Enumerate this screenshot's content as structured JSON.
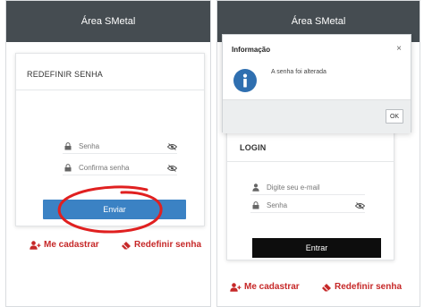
{
  "left": {
    "header_title": "Área SMetal",
    "card_title": "REDEFINIR SENHA",
    "password_placeholder": "Senha",
    "confirm_placeholder": "Confirma senha",
    "submit_label": "Enviar",
    "register_link": "Me cadastrar",
    "reset_link": "Redefinir senha"
  },
  "right": {
    "header_title": "Área SMetal",
    "card_title": "LOGIN",
    "email_placeholder": "Digite seu e-mail",
    "password_placeholder": "Senha",
    "submit_label": "Entrar",
    "register_link": "Me cadastrar",
    "reset_link": "Redefinir senha"
  },
  "modal": {
    "title": "Informação",
    "close_glyph": "×",
    "message": "A senha foi alterada",
    "ok_label": "OK"
  },
  "colors": {
    "header_bg": "#454c51",
    "primary_blue": "#3b82c4",
    "link_red": "#c62828",
    "annotation_red": "#e02020"
  },
  "icons": {
    "lock": "lock-icon",
    "eye_slash": "eye-slash-icon",
    "user": "user-icon",
    "user_plus": "user-plus-icon",
    "eraser": "eraser-icon",
    "info": "info-icon"
  }
}
